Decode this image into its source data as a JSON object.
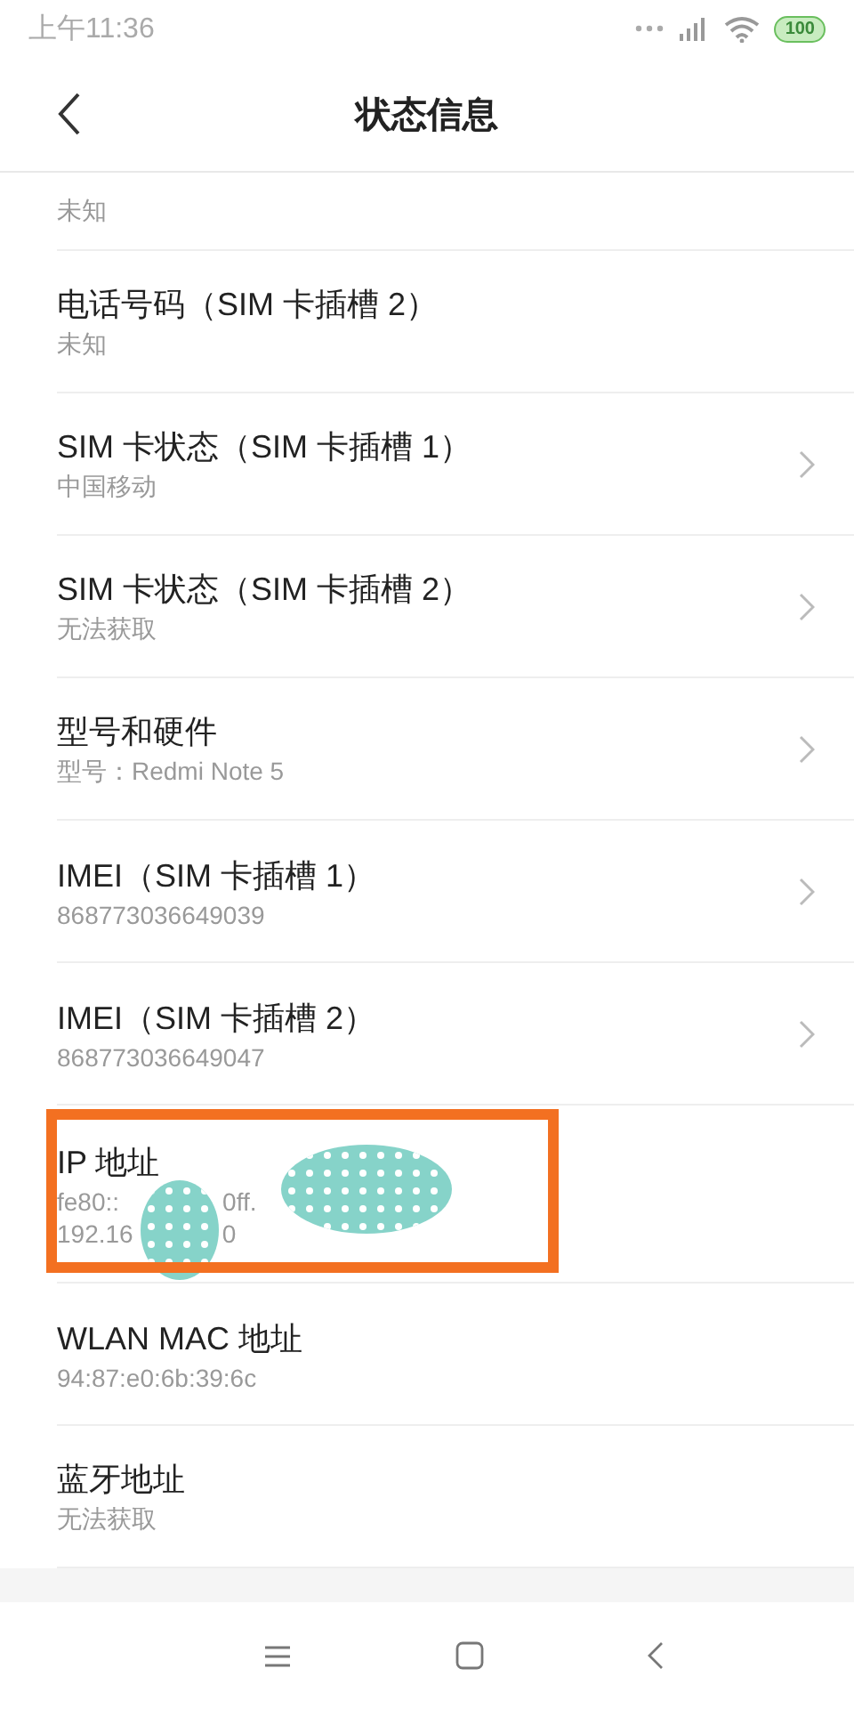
{
  "status_bar": {
    "time": "上午11:36",
    "battery": "100"
  },
  "header": {
    "title": "状态信息"
  },
  "items": [
    {
      "kind": "cut",
      "subtitle": "未知",
      "chevron": false
    },
    {
      "kind": "plain",
      "title": "电话号码（SIM 卡插槽 2）",
      "subtitle": "未知",
      "chevron": false
    },
    {
      "kind": "plain",
      "title": "SIM 卡状态（SIM 卡插槽 1）",
      "subtitle": "中国移动",
      "chevron": true
    },
    {
      "kind": "plain",
      "title": "SIM 卡状态（SIM 卡插槽 2）",
      "subtitle": "无法获取",
      "chevron": true
    },
    {
      "kind": "plain",
      "title": "型号和硬件",
      "subtitle": "型号：Redmi Note 5",
      "chevron": true
    },
    {
      "kind": "plain",
      "title": "IMEI（SIM 卡插槽 1）",
      "subtitle": "868773036649039",
      "chevron": true
    },
    {
      "kind": "plain",
      "title": "IMEI（SIM 卡插槽 2）",
      "subtitle": "868773036649047",
      "chevron": true
    },
    {
      "kind": "redacted",
      "title": "IP 地址",
      "lines": [
        [
          "fe80::",
          "0ff."
        ],
        [
          "192.16",
          "0"
        ]
      ],
      "highlighted": true,
      "chevron": false
    },
    {
      "kind": "plain",
      "title": "WLAN MAC 地址",
      "subtitle": "94:87:e0:6b:39:6c",
      "chevron": false
    },
    {
      "kind": "plain",
      "title": "蓝牙地址",
      "subtitle": "无法获取",
      "chevron": false
    }
  ]
}
